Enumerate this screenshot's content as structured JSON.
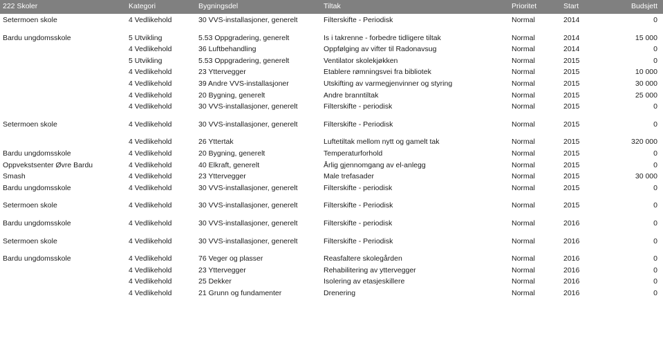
{
  "report": {
    "colors": {
      "header_background": "#808080",
      "header_text": "#ffffff",
      "body_text": "#1b1b1b",
      "page_background": "#ffffff"
    },
    "columns": [
      {
        "key": "skole",
        "label": "222 Skoler"
      },
      {
        "key": "kategori",
        "label": "Kategori"
      },
      {
        "key": "bygg",
        "label": "Bygningsdel"
      },
      {
        "key": "tiltak",
        "label": "Tiltak"
      },
      {
        "key": "prio",
        "label": "Prioritet"
      },
      {
        "key": "start",
        "label": "Start"
      },
      {
        "key": "budsjett",
        "label": "Budsjett"
      }
    ],
    "rows": [
      {
        "skole": "Setermoen skole",
        "kategori": "4 Vedlikehold",
        "bygg": "30 VVS-installasjoner, generelt",
        "tiltak": "Filterskifte - Periodisk",
        "prio": "Normal",
        "start": "2014",
        "budsjett": "0",
        "group_start": false
      },
      {
        "skole": "Bardu ungdomsskole",
        "kategori": "5 Utvikling",
        "bygg": "5.53 Oppgradering, generelt",
        "tiltak": "Is i takrenne - forbedre tidligere tiltak",
        "prio": "Normal",
        "start": "2014",
        "budsjett": "15 000",
        "group_start": true
      },
      {
        "skole": "",
        "kategori": "4 Vedlikehold",
        "bygg": "36 Luftbehandling",
        "tiltak": "Oppfølging av vifter til Radonavsug",
        "prio": "Normal",
        "start": "2014",
        "budsjett": "0",
        "group_start": false
      },
      {
        "skole": "",
        "kategori": "5 Utvikling",
        "bygg": "5.53 Oppgradering, generelt",
        "tiltak": "Ventilator skolekjøkken",
        "prio": "Normal",
        "start": "2015",
        "budsjett": "0",
        "group_start": false
      },
      {
        "skole": "",
        "kategori": "4 Vedlikehold",
        "bygg": "23 Yttervegger",
        "tiltak": "Etablere rømningsvei fra bibliotek",
        "prio": "Normal",
        "start": "2015",
        "budsjett": "10 000",
        "group_start": false
      },
      {
        "skole": "",
        "kategori": "4 Vedlikehold",
        "bygg": "39 Andre VVS-installasjoner",
        "tiltak": "Utskifting av varmegjenvinner og styring",
        "prio": "Normal",
        "start": "2015",
        "budsjett": "30 000",
        "group_start": false
      },
      {
        "skole": "",
        "kategori": "4 Vedlikehold",
        "bygg": "20 Bygning, generelt",
        "tiltak": "Andre branntiltak",
        "prio": "Normal",
        "start": "2015",
        "budsjett": "25 000",
        "group_start": false
      },
      {
        "skole": "",
        "kategori": "4 Vedlikehold",
        "bygg": "30 VVS-installasjoner, generelt",
        "tiltak": "Filterskifte - periodisk",
        "prio": "Normal",
        "start": "2015",
        "budsjett": "0",
        "group_start": false
      },
      {
        "skole": "Setermoen skole",
        "kategori": "4 Vedlikehold",
        "bygg": "30 VVS-installasjoner, generelt",
        "tiltak": "Filterskifte - Periodisk",
        "prio": "Normal",
        "start": "2015",
        "budsjett": "0",
        "group_start": true
      },
      {
        "skole": "",
        "kategori": "4 Vedlikehold",
        "bygg": "26 Yttertak",
        "tiltak": "Luftetiltak mellom nytt og gamelt tak",
        "prio": "Normal",
        "start": "2015",
        "budsjett": "320 000",
        "group_start": true
      },
      {
        "skole": "Bardu ungdomsskole",
        "kategori": "4 Vedlikehold",
        "bygg": "20 Bygning, generelt",
        "tiltak": "Temperaturforhold",
        "prio": "Normal",
        "start": "2015",
        "budsjett": "0",
        "group_start": false
      },
      {
        "skole": "Oppvekstsenter Øvre Bardu",
        "kategori": "4 Vedlikehold",
        "bygg": "40 Elkraft, generelt",
        "tiltak": "Årlig gjennomgang av el-anlegg",
        "prio": "Normal",
        "start": "2015",
        "budsjett": "0",
        "group_start": false
      },
      {
        "skole": "Smash",
        "kategori": "4 Vedlikehold",
        "bygg": "23 Yttervegger",
        "tiltak": "Male trefasader",
        "prio": "Normal",
        "start": "2015",
        "budsjett": "30 000",
        "group_start": false
      },
      {
        "skole": "Bardu ungdomsskole",
        "kategori": "4 Vedlikehold",
        "bygg": "30 VVS-installasjoner, generelt",
        "tiltak": "Filterskifte - periodisk",
        "prio": "Normal",
        "start": "2015",
        "budsjett": "0",
        "group_start": false
      },
      {
        "skole": "Setermoen skole",
        "kategori": "4 Vedlikehold",
        "bygg": "30 VVS-installasjoner, generelt",
        "tiltak": "Filterskifte - Periodisk",
        "prio": "Normal",
        "start": "2015",
        "budsjett": "0",
        "group_start": true
      },
      {
        "skole": "Bardu ungdomsskole",
        "kategori": "4 Vedlikehold",
        "bygg": "30 VVS-installasjoner, generelt",
        "tiltak": "Filterskifte - periodisk",
        "prio": "Normal",
        "start": "2016",
        "budsjett": "0",
        "group_start": true
      },
      {
        "skole": "Setermoen skole",
        "kategori": "4 Vedlikehold",
        "bygg": "30 VVS-installasjoner, generelt",
        "tiltak": "Filterskifte - Periodisk",
        "prio": "Normal",
        "start": "2016",
        "budsjett": "0",
        "group_start": true
      },
      {
        "skole": "Bardu ungdomsskole",
        "kategori": "4 Vedlikehold",
        "bygg": "76 Veger og plasser",
        "tiltak": "Reasfaltere skolegården",
        "prio": "Normal",
        "start": "2016",
        "budsjett": "0",
        "group_start": true
      },
      {
        "skole": "",
        "kategori": "4 Vedlikehold",
        "bygg": "23 Yttervegger",
        "tiltak": "Rehabilitering av yttervegger",
        "prio": "Normal",
        "start": "2016",
        "budsjett": "0",
        "group_start": false
      },
      {
        "skole": "",
        "kategori": "4 Vedlikehold",
        "bygg": "25 Dekker",
        "tiltak": "Isolering av etasjeskillere",
        "prio": "Normal",
        "start": "2016",
        "budsjett": "0",
        "group_start": false
      },
      {
        "skole": "",
        "kategori": "4 Vedlikehold",
        "bygg": "21 Grunn og fundamenter",
        "tiltak": "Drenering",
        "prio": "Normal",
        "start": "2016",
        "budsjett": "0",
        "group_start": false
      }
    ]
  }
}
